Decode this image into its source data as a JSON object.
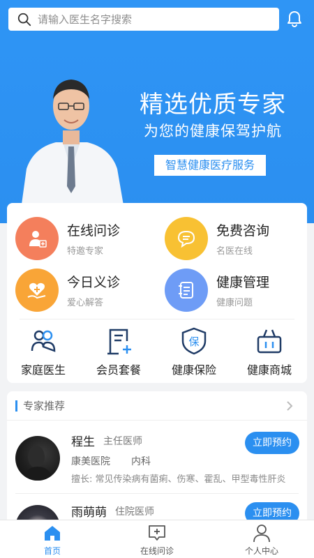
{
  "search": {
    "placeholder": "请输入医生名字搜索"
  },
  "banner": {
    "title": "精选优质专家",
    "subtitle": "为您的健康保驾护航",
    "tag": "智慧健康医疗服务"
  },
  "services": [
    {
      "title": "在线问诊",
      "sub": "特邀专家",
      "icon": "doctor-plus-icon",
      "color": "#f47f5c"
    },
    {
      "title": "免费咨询",
      "sub": "名医在线",
      "icon": "chat-bubble-icon",
      "color": "#f8c133"
    },
    {
      "title": "今日义诊",
      "sub": "爱心解答",
      "icon": "heart-hand-icon",
      "color": "#f9a537"
    },
    {
      "title": "健康管理",
      "sub": "健康问题",
      "icon": "health-record-icon",
      "color": "#6e9cf6"
    }
  ],
  "mini_services": [
    {
      "label": "家庭医生",
      "icon": "family-doctor-icon"
    },
    {
      "label": "会员套餐",
      "icon": "membership-icon"
    },
    {
      "label": "健康保险",
      "icon": "insurance-shield-icon"
    },
    {
      "label": "健康商城",
      "icon": "shopping-basket-icon"
    }
  ],
  "experts": {
    "title": "专家推荐",
    "doctors": [
      {
        "name": "程生",
        "title": "主任医师",
        "hospital": "康美医院",
        "dept": "内科",
        "skill": "擅长: 常见传染病有菌痢、伤寒、霍乱、甲型毒性肝炎",
        "button": "立即预约"
      },
      {
        "name": "雨萌萌",
        "title": "住院医师",
        "button": "立即预约"
      }
    ]
  },
  "nav": [
    {
      "label": "首页",
      "icon": "home-icon",
      "active": true
    },
    {
      "label": "在线问诊",
      "icon": "consult-icon",
      "active": false
    },
    {
      "label": "个人中心",
      "icon": "user-icon",
      "active": false
    }
  ],
  "colors": {
    "primary": "#2b8ff0",
    "background": "#f2f3f5"
  }
}
